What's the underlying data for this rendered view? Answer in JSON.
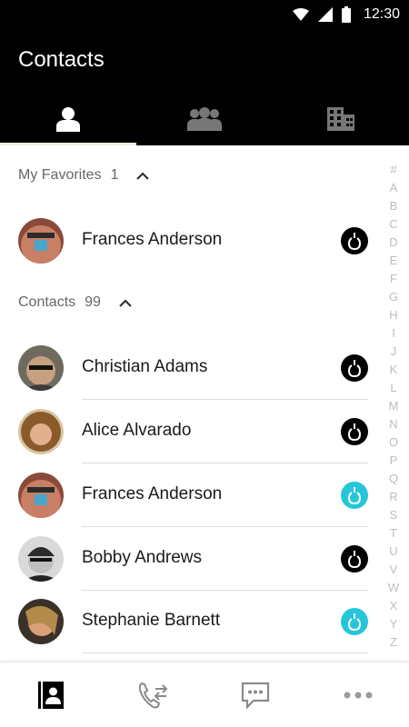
{
  "status_bar": {
    "time": "12:30",
    "icons": [
      "wifi-icon",
      "signal-icon",
      "battery-icon"
    ]
  },
  "header": {
    "title": "Contacts"
  },
  "tabs": [
    {
      "icon": "person-icon",
      "active": true
    },
    {
      "icon": "group-icon",
      "active": false
    },
    {
      "icon": "building-icon",
      "active": false
    }
  ],
  "favorites": {
    "label": "My Favorites",
    "count": "1",
    "contacts": [
      {
        "name": "Frances Anderson",
        "status": "dark"
      }
    ]
  },
  "contacts": {
    "label": "Contacts",
    "count": "99",
    "items": [
      {
        "name": "Christian Adams",
        "status": "dark"
      },
      {
        "name": "Alice Alvarado",
        "status": "dark"
      },
      {
        "name": "Frances Anderson",
        "status": "cyan"
      },
      {
        "name": "Bobby Andrews",
        "status": "dark"
      },
      {
        "name": "Stephanie Barnett",
        "status": "cyan"
      }
    ]
  },
  "alphabet": [
    "#",
    "A",
    "B",
    "C",
    "D",
    "E",
    "F",
    "G",
    "H",
    "I",
    "J",
    "K",
    "L",
    "M",
    "N",
    "O",
    "P",
    "Q",
    "R",
    "S",
    "T",
    "U",
    "V",
    "W",
    "X",
    "Y",
    "Z"
  ],
  "bottom_nav": [
    {
      "icon": "contacts-book-icon",
      "active": true
    },
    {
      "icon": "call-log-icon",
      "active": false
    },
    {
      "icon": "messages-icon",
      "active": false
    },
    {
      "icon": "more-icon",
      "active": false
    }
  ],
  "colors": {
    "status_dark": "#000000",
    "status_cyan": "#26c6da",
    "tab_indicator": "#f1ecd9",
    "header_bg": "#000000"
  }
}
